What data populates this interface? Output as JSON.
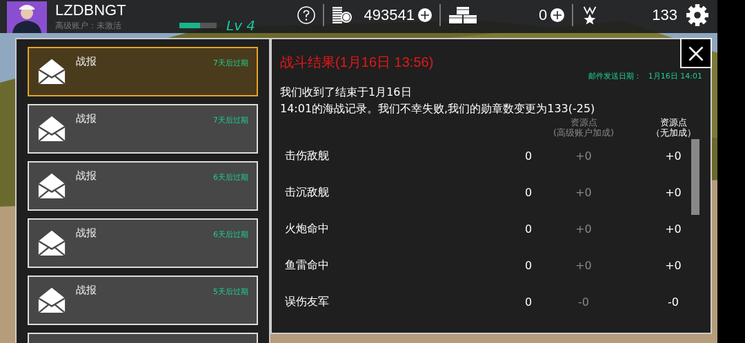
{
  "player": {
    "name": "LZDBNGT",
    "account_status": "高级账户：未激活",
    "level_label": "Lv 4",
    "level": 0.55
  },
  "resources": [
    {
      "kind": "coins",
      "value": "493541",
      "addable": true
    },
    {
      "kind": "crates",
      "value": "0",
      "addable": true
    },
    {
      "kind": "medals",
      "value": "133",
      "addable": false
    }
  ],
  "mail_list": {
    "items": [
      {
        "title": "战报",
        "expiry": "7天后过期",
        "selected": true
      },
      {
        "title": "战报",
        "expiry": "7天后过期",
        "selected": false
      },
      {
        "title": "战报",
        "expiry": "6天后过期",
        "selected": false
      },
      {
        "title": "战报",
        "expiry": "6天后过期",
        "selected": false
      },
      {
        "title": "战报",
        "expiry": "5天后过期",
        "selected": false
      }
    ]
  },
  "mail_detail": {
    "title": "战斗结果(1月16日 13:56)",
    "sent_label": "邮件发送日期：",
    "sent_date": "1月16日 14:01",
    "body_lines": [
      "我们收到了结束于1月16日",
      "14:01的海战记录。我们不幸失败,我们的勋章数变更为133(-25)"
    ],
    "columns": [
      {
        "label": "资源点",
        "sub": "(高级账户加成)",
        "dim": true
      },
      {
        "label": "资源点",
        "sub": "（无加成）",
        "dim": false
      }
    ],
    "rows": [
      {
        "label": "击伤敌舰",
        "count": "0",
        "premium": "+0",
        "base": "+0"
      },
      {
        "label": "击沉敌舰",
        "count": "0",
        "premium": "+0",
        "base": "+0"
      },
      {
        "label": "火炮命中",
        "count": "0",
        "premium": "+0",
        "base": "+0"
      },
      {
        "label": "鱼雷命中",
        "count": "0",
        "premium": "+0",
        "base": "+0"
      },
      {
        "label": "误伤友军",
        "count": "0",
        "premium": "-0",
        "base": "-0"
      }
    ]
  }
}
